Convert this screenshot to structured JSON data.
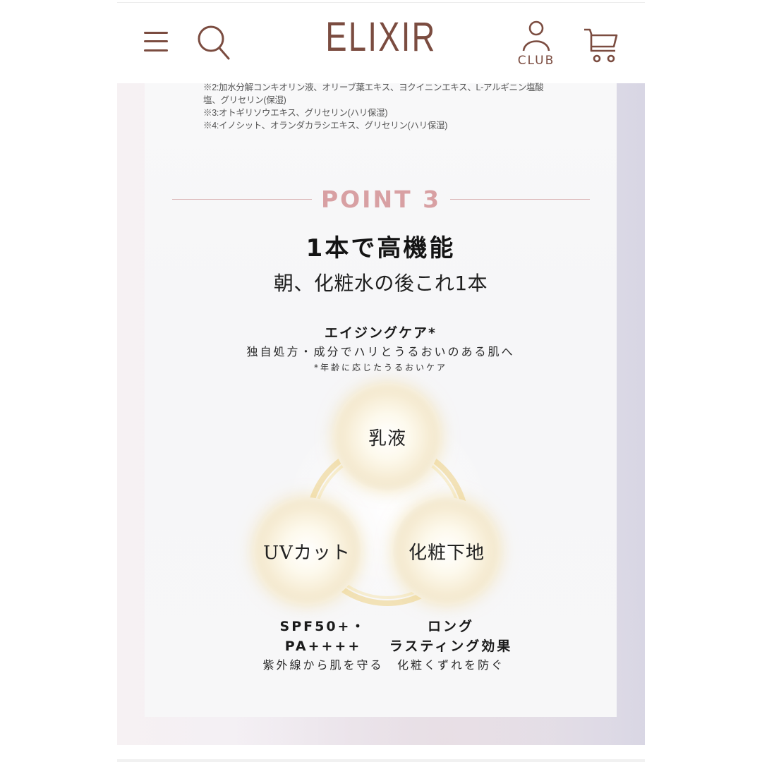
{
  "header": {
    "logo": "ELIXIR",
    "club_label": "CLUB",
    "icons": [
      "menu-icon",
      "search-icon",
      "user-icon",
      "cart-icon"
    ],
    "brand_color": "#7b4c40"
  },
  "notes": [
    "※2:加水分解コンキオリン液、オリーブ葉エキス、ヨクイニンエキス、L-アルギニン塩酸",
    "塩、グリセリン(保湿)",
    "※3:オトギリソウエキス、グリセリン(ハリ保湿)",
    "※4:イノシット、オランダカラシエキス、グリセリン(ハリ保湿)"
  ],
  "point": {
    "label": "POINT 3",
    "accent_color": "#d8a0a3",
    "headline": "1本で高機能",
    "subhead": "朝、化粧水の後これ1本"
  },
  "feature_top": {
    "title": "エイジングケア*",
    "description": "独自処方・成分でハリとうるおいのある肌へ",
    "note": "*年齢に応じたうるおいケア"
  },
  "orbs": {
    "top": "乳液",
    "left": "UVカット",
    "right": "化粧下地"
  },
  "features_bottom": {
    "left": {
      "title": "SPF50+・\nPA++++",
      "description": "紫外線から肌を守る"
    },
    "right": {
      "title": "ロング\nラスティング効果",
      "description": "化粧くずれを防ぐ"
    }
  }
}
